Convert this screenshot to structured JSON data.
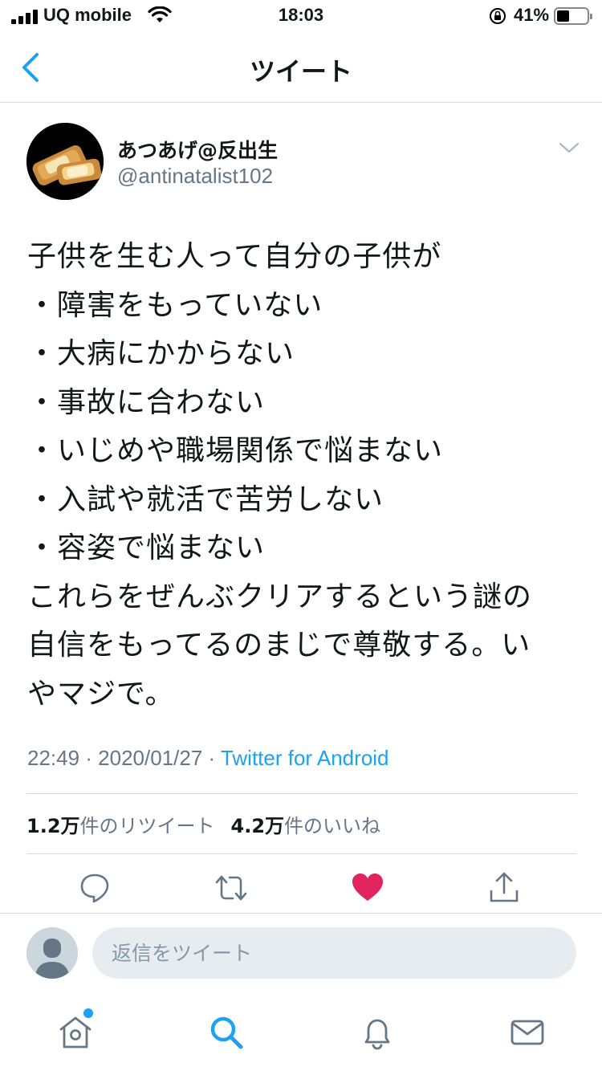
{
  "status_bar": {
    "carrier": "UQ mobile",
    "time": "18:03",
    "battery_percent": "41%",
    "battery_level": 0.41
  },
  "header": {
    "title": "ツイート"
  },
  "tweet": {
    "display_name": "あつあげ@反出生",
    "handle": "@antinatalist102",
    "lines": [
      "子供を生む人って自分の子供が",
      "・障害をもっていない",
      "・大病にかからない",
      "・事故に合わない",
      "・いじめや職場関係で悩まない",
      "・入試や就活で苦労しない",
      "・容姿で悩まない",
      "これらをぜんぶクリアするという謎の",
      "自信をもってるのまじで尊敬する。い",
      "やマジで。"
    ],
    "timestamp": "22:49 · 2020/01/27 · ",
    "source": "Twitter for Android",
    "retweet_count": "1.2万",
    "retweet_label": "件のリツイート",
    "like_count": "4.2万",
    "like_label": "件のいいね"
  },
  "actions": {
    "reply_icon": "comment-icon",
    "retweet_icon": "retweet-icon",
    "like_icon": "heart-icon",
    "share_icon": "share-icon",
    "liked": true
  },
  "reply": {
    "placeholder": "返信をツイート"
  },
  "tab_bar": {
    "items": [
      "home-icon",
      "search-icon",
      "bell-icon",
      "mail-icon"
    ],
    "active": "search-icon"
  },
  "colors": {
    "accent": "#1da1f2",
    "like": "#e0245e",
    "secondary_text": "#657786"
  }
}
